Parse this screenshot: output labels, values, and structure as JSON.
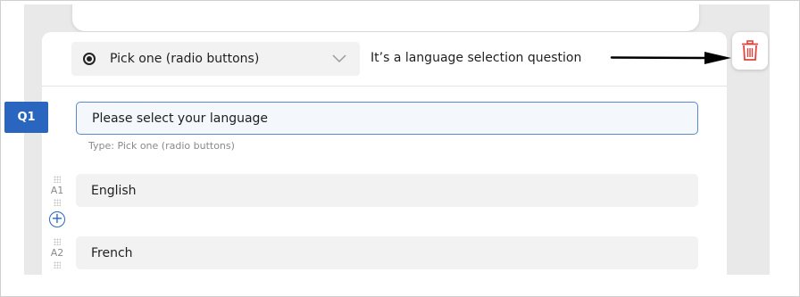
{
  "question_type": {
    "label": "Pick one (radio buttons)",
    "icon": "radio-selected-icon"
  },
  "question_note": "It’s a language selection question",
  "question": {
    "number": "Q1",
    "text": "Please select your language",
    "meta": "Type: Pick one (radio buttons)"
  },
  "answers": [
    {
      "number": "A1",
      "text": "English"
    },
    {
      "number": "A2",
      "text": "French"
    }
  ],
  "colors": {
    "accent": "#2a66c0",
    "delete": "#e0443e"
  }
}
